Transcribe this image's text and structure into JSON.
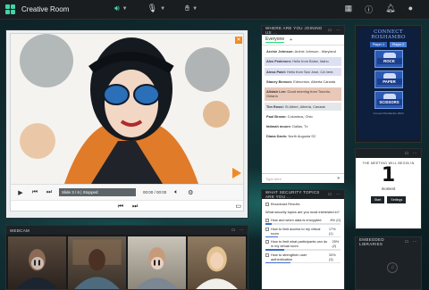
{
  "app": {
    "room_title": "Creative Room"
  },
  "topbar": {
    "audio_icon": "speaker-icon",
    "mic_icon": "microphone-icon",
    "raise_hand_icon": "hand-icon",
    "right_icons": [
      "grid-icon",
      "help-icon",
      "notifications-icon",
      "user-icon"
    ]
  },
  "presentation": {
    "slide_label": "Slide 3 / 6 | Stopped",
    "time_label": "00:00 / 00:00"
  },
  "webcam": {
    "title": "WEBCAM"
  },
  "joining": {
    "title": "WHERE ARE YOU JOINING US ...",
    "tab_everyone": "Everyone",
    "messages": [
      {
        "name": "Archie Johnson:",
        "text": "Archie Johnson - Maryland",
        "style": "plain"
      },
      {
        "name": "Alex Pedersen:",
        "text": "Hello from Boise, Idaho",
        "style": "alt"
      },
      {
        "name": "Alexa Patel:",
        "text": "Hello from San Jose, CA here.",
        "style": "alt"
      },
      {
        "name": "Stacey Benson:",
        "text": "Edmonton, Alberta Canada",
        "style": "plain"
      },
      {
        "name": "Alistair Lee:",
        "text": "Good morning from Toronto, Ontario",
        "style": "hl"
      },
      {
        "name": "Tim Rossi:",
        "text": "St Albert, Alberta, Canada",
        "style": "gray"
      },
      {
        "name": "Paul Brown:",
        "text": "Columbus, Ohio",
        "style": "plain"
      },
      {
        "name": "fatimah moore:",
        "text": "Dallas, Tx",
        "style": "plain"
      },
      {
        "name": "Diana Davis:",
        "text": "North Augusta SC",
        "style": "plain"
      }
    ],
    "type_here": "Type here"
  },
  "poll": {
    "title": "WHAT SECURITY TOPICS ARE YOU ...",
    "broadcast_label": "Broadcast Results",
    "question": "What security topics are you most interested in?",
    "options": [
      {
        "label": "How and when data is encrypted",
        "pct": "8%",
        "votes": "0",
        "fill": 0.08
      },
      {
        "label": "How to limit access to my virtual room",
        "pct": "17%",
        "votes": "1",
        "fill": 0.17
      },
      {
        "label": "How to limit what participants can do in my virtual room",
        "pct": "25%",
        "votes": "2",
        "fill": 0.25
      },
      {
        "label": "How to strengthen user authentication",
        "pct": "33%",
        "votes": "3",
        "fill": 0.33
      }
    ]
  },
  "roshambo": {
    "title": "CONNECT ROSHAMBO",
    "player1": "Player 1",
    "player2": "Player 2",
    "choices": [
      "ROCK",
      "PAPER",
      "SCISSORS"
    ],
    "footer": "Connect Roshambo 2023"
  },
  "timer": {
    "caption": "THE MEETING WILL BEGIN IN",
    "value": "1",
    "unit": "moment",
    "start": "Start",
    "settings": "Settings"
  },
  "libraries": {
    "title": "EMBEDDED LIBRARIES"
  }
}
